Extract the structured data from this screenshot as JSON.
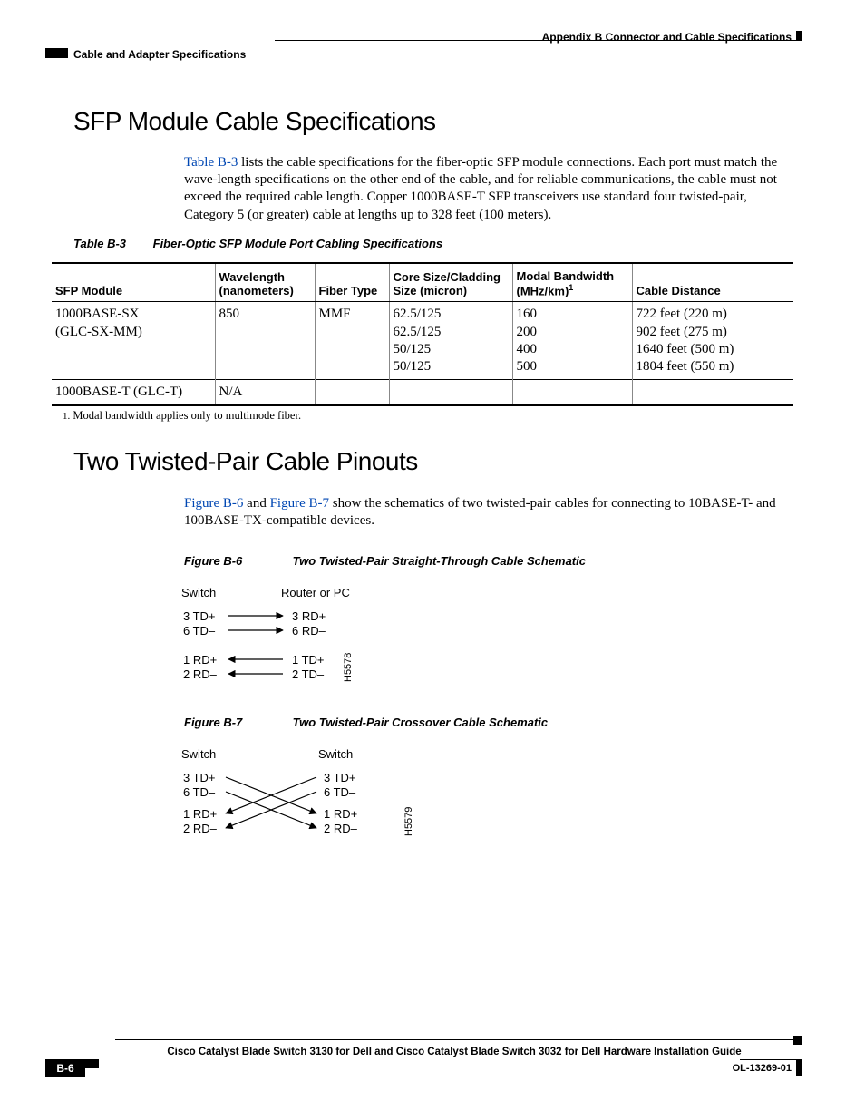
{
  "header": {
    "right": "Appendix B    Connector and Cable Specifications",
    "left": "Cable and Adapter Specifications"
  },
  "sections": {
    "sfp_title": "SFP Module Cable Specifications",
    "sfp_para_link": "Table B-3",
    "sfp_para_rest": " lists the cable specifications for the fiber-optic SFP module connections. Each port must match the wave-length specifications on the other end of the cable, and for reliable communications, the cable must not exceed the required cable length. Copper 1000BASE-T SFP transceivers use standard four twisted-pair, Category 5 (or greater) cable at lengths up to 328 feet (100 meters).",
    "twist_title": "Two Twisted-Pair Cable Pinouts",
    "twist_link1": "Figure B-6",
    "twist_mid": " and ",
    "twist_link2": "Figure B-7",
    "twist_rest": " show the schematics of two twisted-pair cables for connecting to 10BASE-T- and 100BASE-TX-compatible devices."
  },
  "table": {
    "caption_num": "Table B-3",
    "caption_text": "Fiber-Optic SFP Module Port Cabling Specifications",
    "headers": {
      "c1": "SFP Module",
      "c2": "Wavelength (nanometers)",
      "c3": "Fiber Type",
      "c4": "Core Size/Cladding Size (micron)",
      "c5a": "Modal Bandwidth (MHz/km)",
      "c5sup": "1",
      "c6": "Cable Distance"
    },
    "rows": [
      {
        "module": "1000BASE-SX\n(GLC-SX-MM)",
        "wavelength": "850",
        "fiber": "MMF",
        "core": "62.5/125\n62.5/125\n50/125\n50/125",
        "bw": "160\n200\n400\n500",
        "dist": "722 feet (220 m)\n902 feet (275 m)\n1640 feet (500 m)\n1804 feet (550 m)"
      },
      {
        "module": "1000BASE-T (GLC-T)",
        "wavelength": "N/A",
        "fiber": "",
        "core": "",
        "bw": "",
        "dist": ""
      }
    ],
    "footnote_num": "1.",
    "footnote": "Modal bandwidth applies only to multimode fiber."
  },
  "figures": {
    "f6": {
      "num": "Figure B-6",
      "title": "Two Twisted-Pair Straight-Through Cable Schematic",
      "left_head": "Switch",
      "right_head": "Router or PC",
      "rows_left": [
        "3 TD+",
        "6 TD–",
        "1 RD+",
        "2 RD–"
      ],
      "rows_right": [
        "3 RD+",
        "6 RD–",
        "1 TD+",
        "2 TD–"
      ],
      "code": "H5578"
    },
    "f7": {
      "num": "Figure B-7",
      "title": "Two Twisted-Pair Crossover Cable Schematic",
      "left_head": "Switch",
      "right_head": "Switch",
      "rows_left": [
        "3 TD+",
        "6 TD–",
        "1 RD+",
        "2 RD–"
      ],
      "rows_right": [
        "3 TD+",
        "6 TD–",
        "1 RD+",
        "2 RD–"
      ],
      "code": "H5579"
    }
  },
  "footer": {
    "title": "Cisco Catalyst Blade Switch 3130 for Dell and Cisco Catalyst Blade Switch 3032 for Dell Hardware Installation Guide",
    "page": "B-6",
    "doc": "OL-13269-01"
  }
}
